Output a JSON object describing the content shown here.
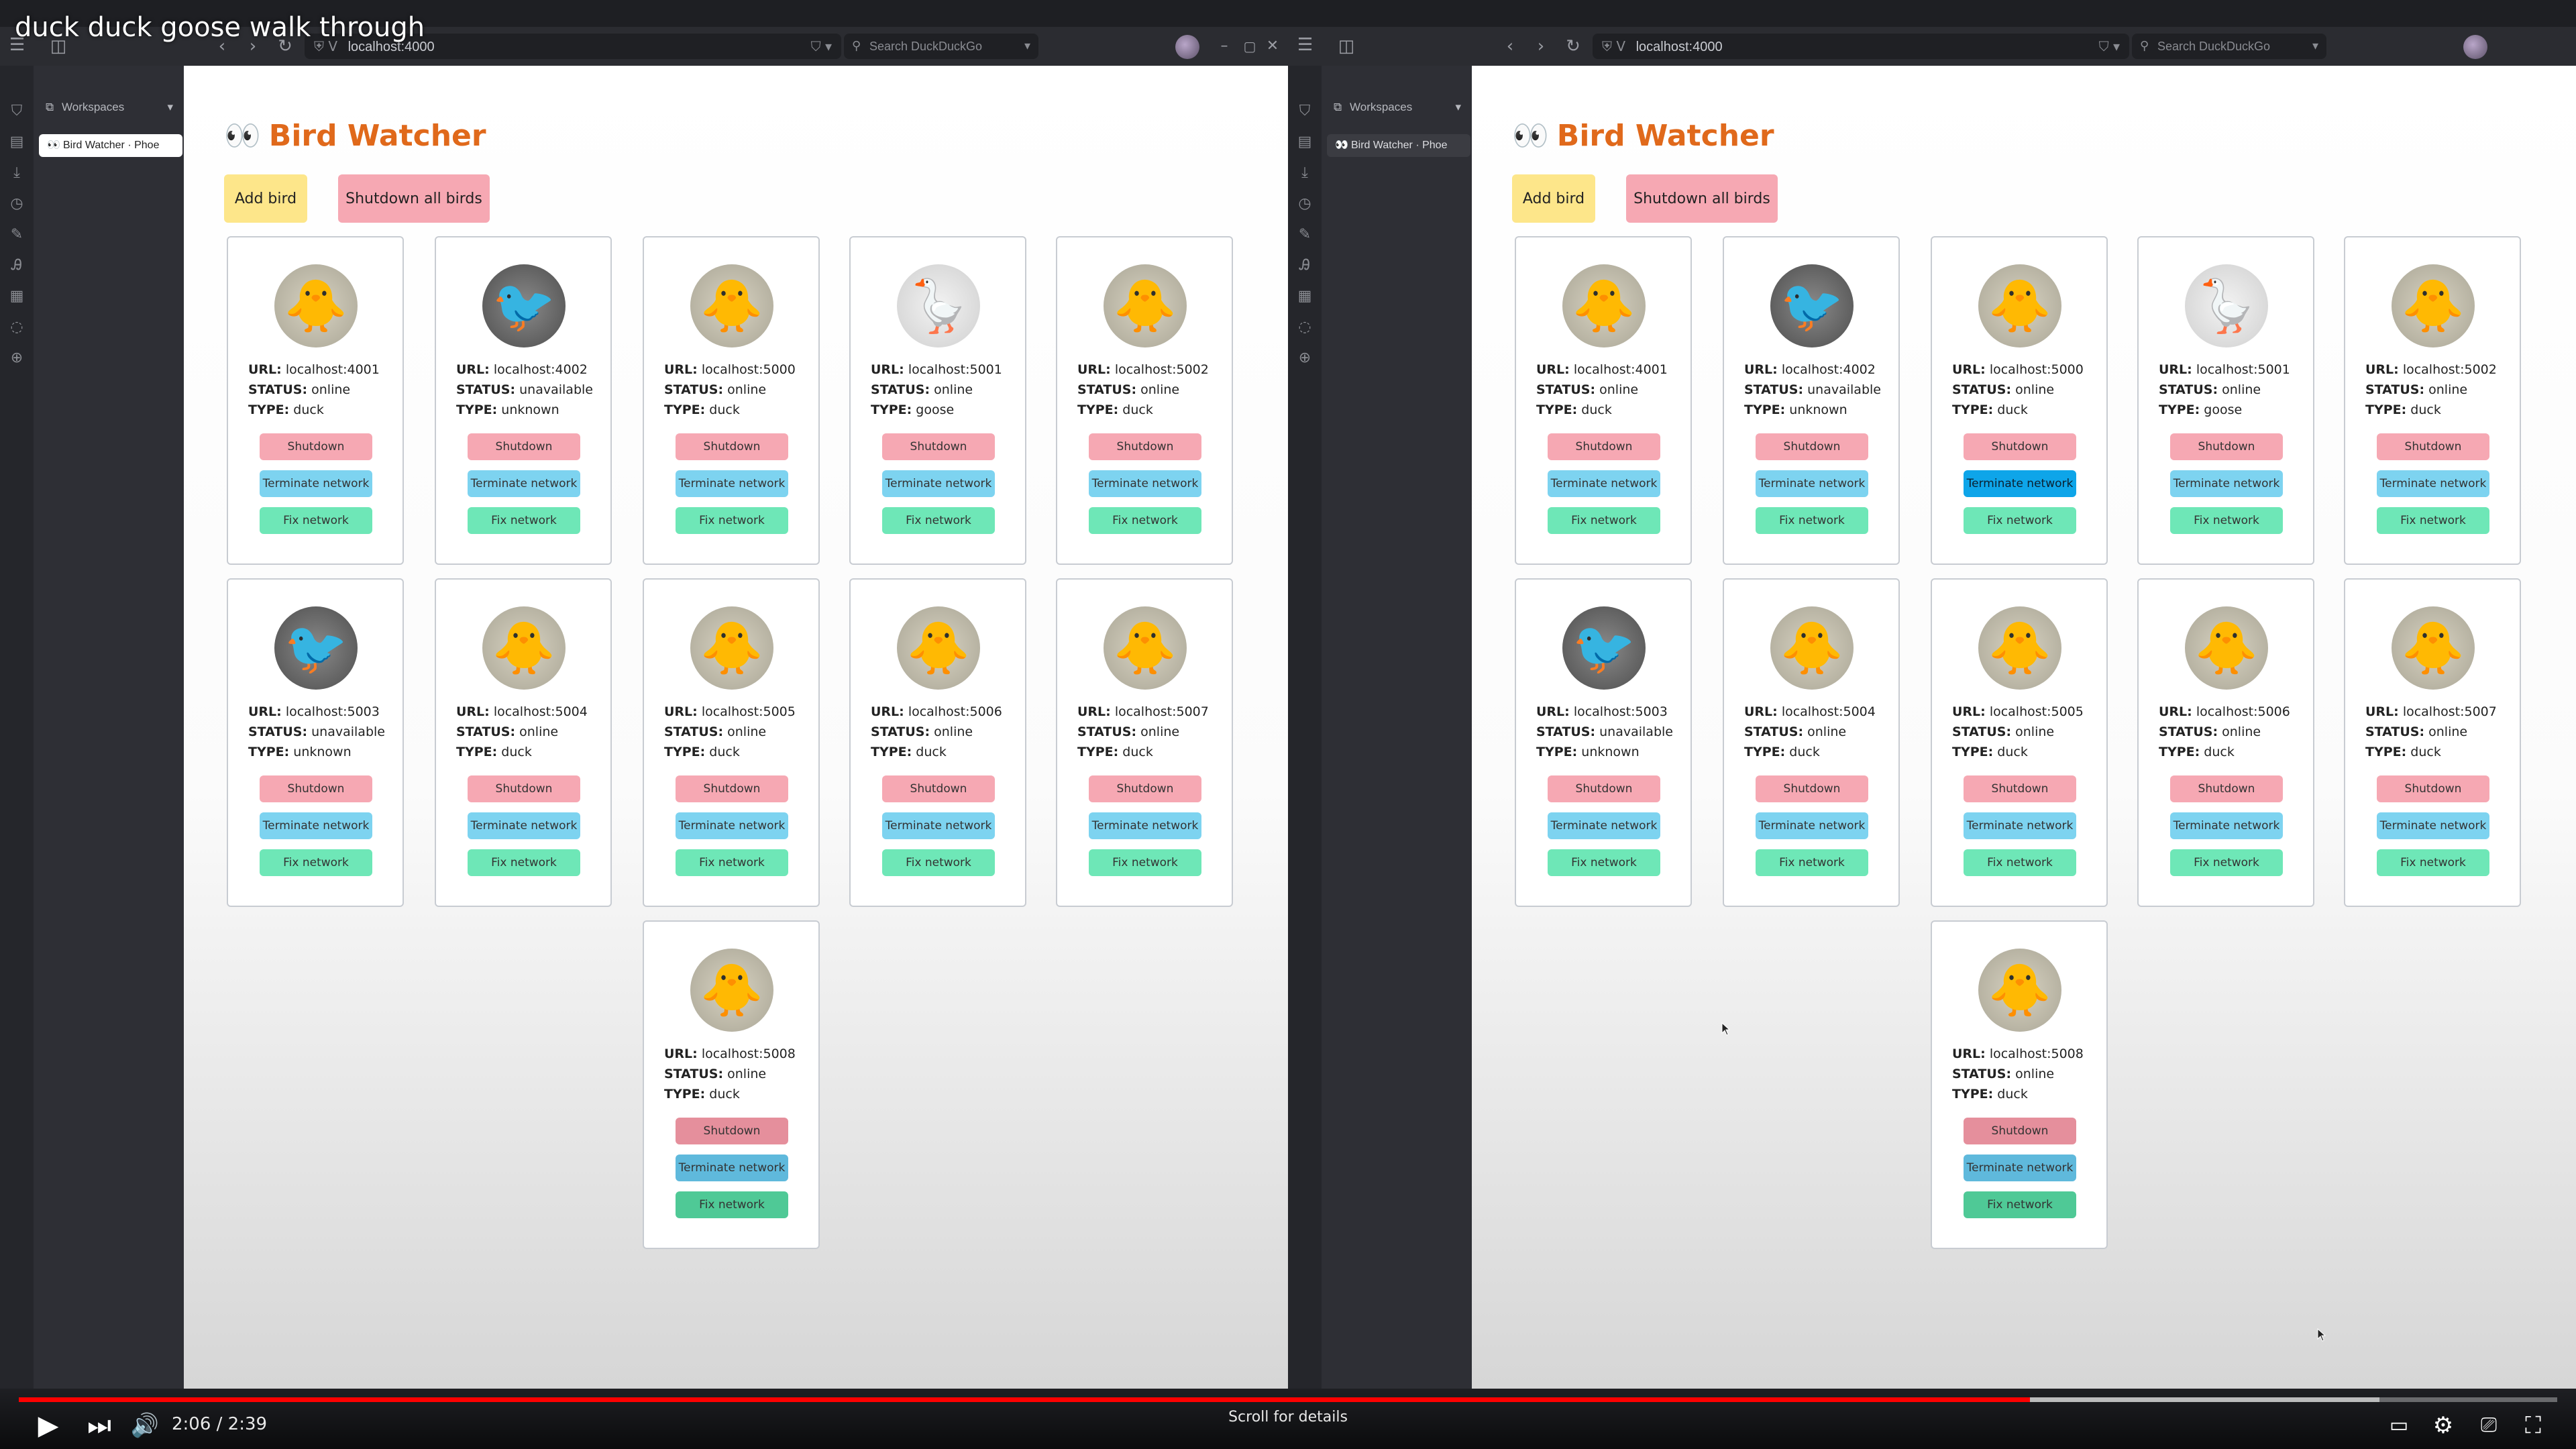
{
  "video": {
    "title": "duck duck goose walk through",
    "time": "2:06 / 2:39",
    "played_fraction": 0.7924,
    "buffered_fraction": 0.93,
    "scroll_hint": "Scroll for details"
  },
  "browser": {
    "url": "localhost:4000",
    "search_placeholder": "Search DuckDuckGo",
    "workspaces_label": "Workspaces",
    "tab_title": "Bird Watcher · Phoe"
  },
  "app": {
    "title": "Bird Watcher",
    "title_emoji": "👀",
    "add_bird_label": "Add bird",
    "shutdown_all_label": "Shutdown all birds",
    "labels": {
      "url": "URL:",
      "status": "STATUS:",
      "type": "TYPE:",
      "shutdown": "Shutdown",
      "terminate": "Terminate network",
      "fix": "Fix network"
    },
    "birds": [
      {
        "url": "localhost:4001",
        "status": "online",
        "type": "duck"
      },
      {
        "url": "localhost:4002",
        "status": "unavailable",
        "type": "unknown"
      },
      {
        "url": "localhost:5000",
        "status": "online",
        "type": "duck"
      },
      {
        "url": "localhost:5001",
        "status": "online",
        "type": "goose"
      },
      {
        "url": "localhost:5002",
        "status": "online",
        "type": "duck"
      },
      {
        "url": "localhost:5003",
        "status": "unavailable",
        "type": "unknown"
      },
      {
        "url": "localhost:5004",
        "status": "online",
        "type": "duck"
      },
      {
        "url": "localhost:5005",
        "status": "online",
        "type": "duck"
      },
      {
        "url": "localhost:5006",
        "status": "online",
        "type": "duck"
      },
      {
        "url": "localhost:5007",
        "status": "online",
        "type": "duck"
      },
      {
        "url": "localhost:5008",
        "status": "online",
        "type": "duck"
      }
    ]
  },
  "colors": {
    "title": "#e0691b",
    "add_button": "#fde68a",
    "shutdown": "#f6a8b3",
    "terminate": "#7dd3f0",
    "terminate_hover": "#0ea5e9",
    "fix": "#6ee7b7",
    "progress": "#ff0000"
  },
  "icons": {
    "duck": "duck-avatar-icon",
    "goose": "goose-avatar-icon",
    "unknown": "robot-bird-avatar-icon"
  }
}
